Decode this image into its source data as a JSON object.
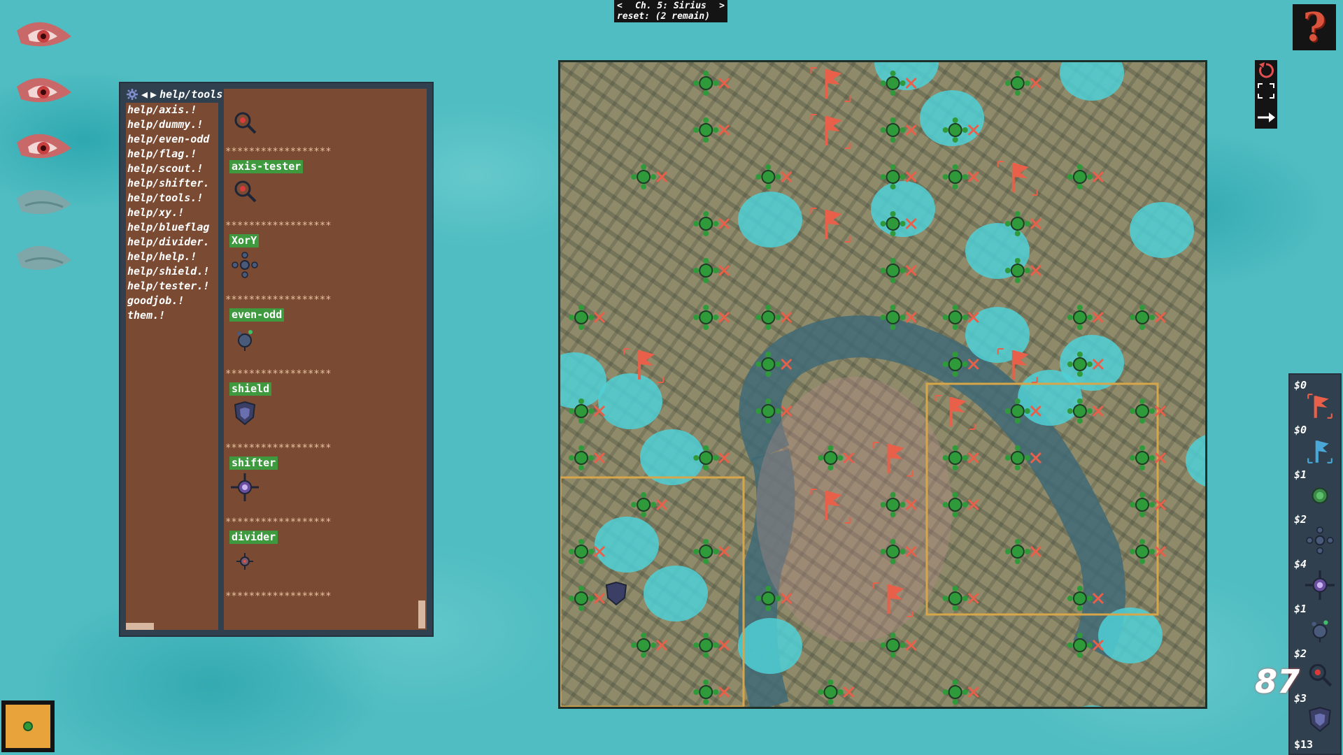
{
  "chapter": {
    "title": "Ch. 5: Sirius",
    "prev": "<",
    "next": ">",
    "reset": "reset: (2 remain)"
  },
  "help_button": {
    "label": "?"
  },
  "lives": {
    "active": 3,
    "total": 5
  },
  "manual": {
    "current": "help/tools.!",
    "nav_prev": "◀",
    "nav_next": "▶",
    "list": [
      "help/axis.!",
      "help/dummy.!",
      "help/even-odd",
      "help/flag.!",
      "help/scout.!",
      "help/shifter.",
      "help/tools.!",
      "help/xy.!",
      "help/blueflag",
      "help/divider.",
      "help/help.!",
      "help/shield.!",
      "help/tester.!",
      "goodjob.!",
      "them.!"
    ],
    "separator": "******************",
    "tools": [
      {
        "label": "axis-tester",
        "icon": "axis-tester-icon"
      },
      {
        "label": "XorY",
        "icon": "xory-icon"
      },
      {
        "label": "even-odd",
        "icon": "even-odd-icon"
      },
      {
        "label": "shield",
        "icon": "shield-icon"
      },
      {
        "label": "shifter",
        "icon": "shifter-icon"
      },
      {
        "label": "divider",
        "icon": "divider-icon"
      }
    ]
  },
  "shop": {
    "items": [
      {
        "price": "$0",
        "icon": "red-flag-icon"
      },
      {
        "price": "$0",
        "icon": "blue-flag-icon"
      },
      {
        "price": "$1",
        "icon": "scout-icon"
      },
      {
        "price": "$2",
        "icon": "xory-icon"
      },
      {
        "price": "$4",
        "icon": "shifter-icon"
      },
      {
        "price": "$1",
        "icon": "even-odd-icon"
      },
      {
        "price": "$2",
        "icon": "tester-icon"
      },
      {
        "price": "$3",
        "icon": "shield-icon"
      }
    ],
    "cash": "$13"
  },
  "flags_remaining": "87",
  "colors": {
    "flag": "#e8604a",
    "marker": "#2f9a3a",
    "water": "#4fd0d6"
  }
}
